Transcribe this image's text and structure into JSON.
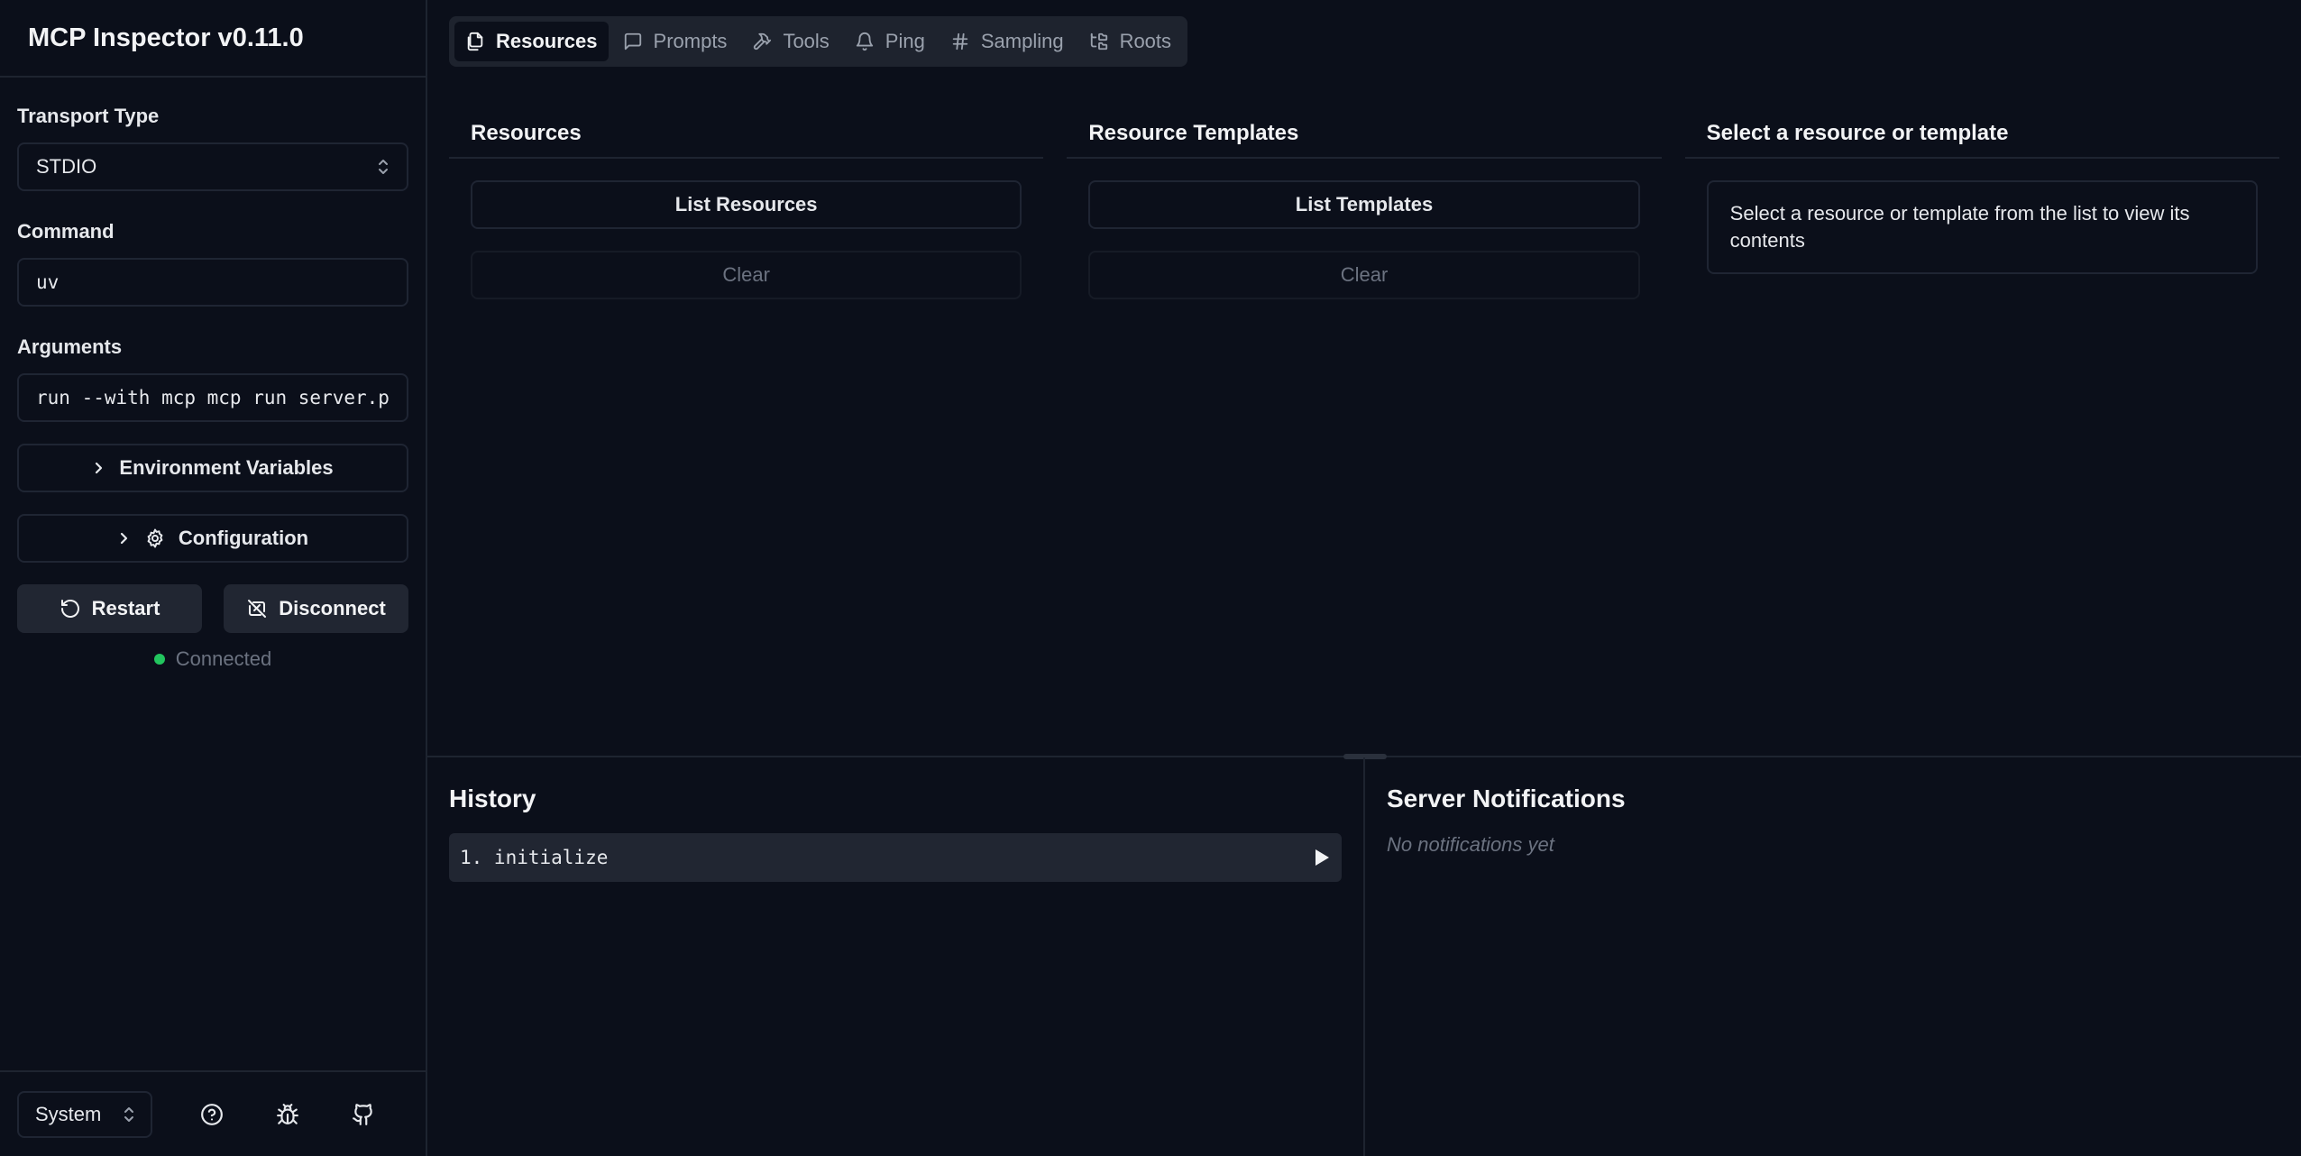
{
  "app": {
    "title": "MCP Inspector v0.11.0"
  },
  "sidebar": {
    "transport_label": "Transport Type",
    "transport_value": "STDIO",
    "command_label": "Command",
    "command_value": "uv",
    "arguments_label": "Arguments",
    "arguments_value": "run --with mcp mcp run server.p",
    "env_button": "Environment Variables",
    "config_button": "Configuration",
    "restart_button": "Restart",
    "disconnect_button": "Disconnect",
    "status_text": "Connected",
    "status_color": "#22c55e",
    "theme_value": "System"
  },
  "tabs": [
    {
      "label": "Resources",
      "icon": "files-icon",
      "active": true
    },
    {
      "label": "Prompts",
      "icon": "message-square-icon"
    },
    {
      "label": "Tools",
      "icon": "hammer-icon"
    },
    {
      "label": "Ping",
      "icon": "bell-icon"
    },
    {
      "label": "Sampling",
      "icon": "hash-icon"
    },
    {
      "label": "Roots",
      "icon": "folder-tree-icon"
    }
  ],
  "resources": {
    "title": "Resources",
    "list_button": "List Resources",
    "clear_button": "Clear"
  },
  "templates": {
    "title": "Resource Templates",
    "list_button": "List Templates",
    "clear_button": "Clear"
  },
  "detail": {
    "title": "Select a resource or template",
    "message": "Select a resource or template from the list to view its contents"
  },
  "history": {
    "title": "History",
    "items": [
      "1. initialize"
    ]
  },
  "notifications": {
    "title": "Server Notifications",
    "empty": "No notifications yet"
  }
}
